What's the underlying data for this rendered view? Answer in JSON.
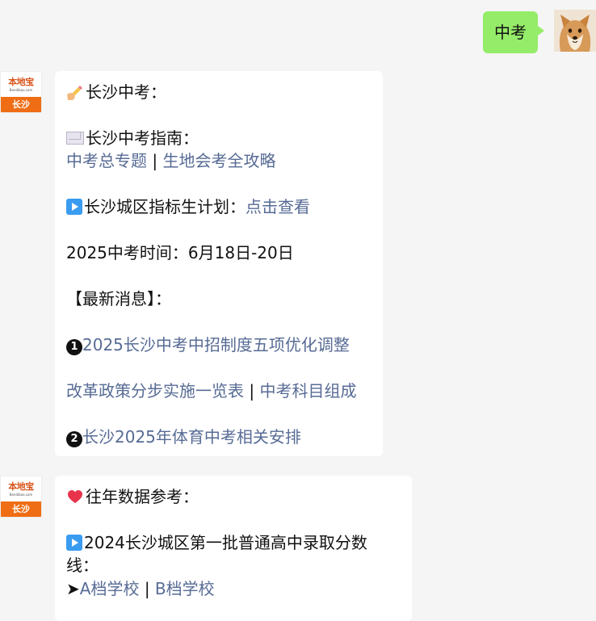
{
  "user_message": {
    "text": "中考"
  },
  "bot_avatar": {
    "logo_text": "本地宝",
    "logo_sub": "Bendibao.com",
    "city": "长沙"
  },
  "message1": {
    "title": "长沙中考：",
    "guide_heading": "长沙中考指南：",
    "guide_links": [
      "中考总专题",
      "生地会考全攻略"
    ],
    "separator": "|",
    "plan_prefix": "长沙城区指标生计划：",
    "plan_link": "点击查看",
    "exam_time": "2025中考时间：6月18日-20日",
    "news_heading": "【最新消息】：",
    "news1_num": "1",
    "news1_link": "2025长沙中考中招制度五项优化调整",
    "news1_sub_links": [
      "改革政策分步实施一览表",
      "中考科目组成"
    ],
    "news2_num": "2",
    "news2_link": "长沙2025年体育中考相关安排"
  },
  "message2": {
    "heading": "往年数据参考：",
    "item_line1": "2024长沙城区第一批普通高中录取分数",
    "item_line2": "线：",
    "arrow": "➤",
    "links": [
      "A档学校",
      "B档学校"
    ]
  },
  "colors": {
    "background": "#f5f5f5",
    "user_bubble": "#95ec69",
    "link": "#576b95",
    "brand_orange": "#ef6d14"
  },
  "icons": {
    "pencil": "writing-hand-icon",
    "envelope": "envelope-icon",
    "play": "play-button-icon",
    "heart": "heart-icon"
  }
}
